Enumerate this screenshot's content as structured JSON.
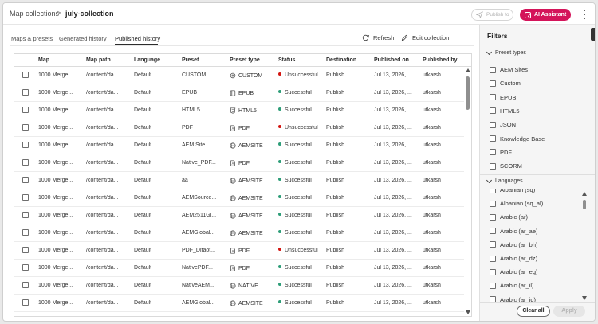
{
  "breadcrumb": {
    "parent": "Map collections",
    "separator": ">",
    "current": "july-collection"
  },
  "header": {
    "publish_label": "Publish to",
    "ai_label": "AI Assistant",
    "ai_color": "#d4145a"
  },
  "tabs": [
    {
      "label": "Maps & presets"
    },
    {
      "label": "Generated history"
    },
    {
      "label": "Published history",
      "active": true
    }
  ],
  "actions": {
    "refresh": "Refresh",
    "edit": "Edit collection"
  },
  "table": {
    "columns": [
      "Map",
      "Map path",
      "Language",
      "Preset",
      "Preset type",
      "Status",
      "Destination",
      "Published on",
      "Published by"
    ],
    "rows": [
      {
        "map": "1000 Merge...",
        "path": "/content/da...",
        "lang": "Default",
        "preset": "CUSTOM",
        "ptype": "CUSTOM",
        "picon": "gear-icon",
        "status": "Unsuccessful",
        "ok": false,
        "dest": "Publish",
        "date": "Jul 13, 2026, ...",
        "by": "utkarsh"
      },
      {
        "map": "1000 Merge...",
        "path": "/content/da...",
        "lang": "Default",
        "preset": "EPUB",
        "ptype": "EPUB",
        "picon": "book-icon",
        "status": "Successful",
        "ok": true,
        "dest": "Publish",
        "date": "Jul 13, 2026, ...",
        "by": "utkarsh"
      },
      {
        "map": "1000 Merge...",
        "path": "/content/da...",
        "lang": "Default",
        "preset": "HTML5",
        "ptype": "HTML5",
        "picon": "html5-icon",
        "status": "Successful",
        "ok": true,
        "dest": "Publish",
        "date": "Jul 13, 2026, ...",
        "by": "utkarsh"
      },
      {
        "map": "1000 Merge...",
        "path": "/content/da...",
        "lang": "Default",
        "preset": "PDF",
        "ptype": "PDF",
        "picon": "pdf-icon",
        "status": "Unsuccessful",
        "ok": false,
        "dest": "Publish",
        "date": "Jul 13, 2026, ...",
        "by": "utkarsh"
      },
      {
        "map": "1000 Merge...",
        "path": "/content/da...",
        "lang": "Default",
        "preset": "AEM Site",
        "ptype": "AEMSITE",
        "picon": "globe-icon",
        "status": "Successful",
        "ok": true,
        "dest": "Publish",
        "date": "Jul 13, 2026, ...",
        "by": "utkarsh"
      },
      {
        "map": "1000 Merge...",
        "path": "/content/da...",
        "lang": "Default",
        "preset": "Native_PDF...",
        "ptype": "PDF",
        "picon": "pdf-icon",
        "status": "Successful",
        "ok": true,
        "dest": "Publish",
        "date": "Jul 13, 2026, ...",
        "by": "utkarsh"
      },
      {
        "map": "1000 Merge...",
        "path": "/content/da...",
        "lang": "Default",
        "preset": "aa",
        "ptype": "AEMSITE",
        "picon": "globe-icon",
        "status": "Successful",
        "ok": true,
        "dest": "Publish",
        "date": "Jul 13, 2026, ...",
        "by": "utkarsh"
      },
      {
        "map": "1000 Merge...",
        "path": "/content/da...",
        "lang": "Default",
        "preset": "AEMSource...",
        "ptype": "AEMSITE",
        "picon": "globe-icon",
        "status": "Successful",
        "ok": true,
        "dest": "Publish",
        "date": "Jul 13, 2026, ...",
        "by": "utkarsh"
      },
      {
        "map": "1000 Merge...",
        "path": "/content/da...",
        "lang": "Default",
        "preset": "AEM2511Gl...",
        "ptype": "AEMSITE",
        "picon": "globe-icon",
        "status": "Successful",
        "ok": true,
        "dest": "Publish",
        "date": "Jul 13, 2026, ...",
        "by": "utkarsh"
      },
      {
        "map": "1000 Merge...",
        "path": "/content/da...",
        "lang": "Default",
        "preset": "AEMGlobal...",
        "ptype": "AEMSITE",
        "picon": "globe-icon",
        "status": "Successful",
        "ok": true,
        "dest": "Publish",
        "date": "Jul 13, 2026, ...",
        "by": "utkarsh"
      },
      {
        "map": "1000 Merge...",
        "path": "/content/da...",
        "lang": "Default",
        "preset": "PDF_Dltaot...",
        "ptype": "PDF",
        "picon": "pdf-icon",
        "status": "Unsuccessful",
        "ok": false,
        "dest": "Publish",
        "date": "Jul 13, 2026, ...",
        "by": "utkarsh"
      },
      {
        "map": "1000 Merge...",
        "path": "/content/da...",
        "lang": "Default",
        "preset": "NativePDF...",
        "ptype": "PDF",
        "picon": "pdf-icon",
        "status": "Successful",
        "ok": true,
        "dest": "Publish",
        "date": "Jul 13, 2026, ...",
        "by": "utkarsh"
      },
      {
        "map": "1000 Merge...",
        "path": "/content/da...",
        "lang": "Default",
        "preset": "NativeAEM...",
        "ptype": "NATIVE...",
        "picon": "globe-icon",
        "status": "Successful",
        "ok": true,
        "dest": "Publish",
        "date": "Jul 13, 2026, ...",
        "by": "utkarsh"
      },
      {
        "map": "1000 Merge...",
        "path": "/content/da...",
        "lang": "Default",
        "preset": "AEMGlobal...",
        "ptype": "AEMSITE",
        "picon": "globe-icon",
        "status": "Successful",
        "ok": true,
        "dest": "Publish",
        "date": "Jul 13, 2026, ...",
        "by": "utkarsh"
      }
    ],
    "status_colors": {
      "ok": "#2d9d78",
      "bad": "#d31510"
    }
  },
  "filters": {
    "title": "Filters",
    "preset_types_label": "Preset types",
    "preset_types": [
      "AEM Sites",
      "Custom",
      "EPUB",
      "HTML5",
      "JSON",
      "Knowledge Base",
      "PDF",
      "SCORM"
    ],
    "languages_label": "Languages",
    "languages": [
      "Albanian (sq)",
      "Albanian (sq_al)",
      "Arabic (ar)",
      "Arabic (ar_ae)",
      "Arabic (ar_bh)",
      "Arabic (ar_dz)",
      "Arabic (ar_eg)",
      "Arabic (ar_il)",
      "Arabic (ar_iq)"
    ],
    "clear_label": "Clear all",
    "apply_label": "Apply"
  }
}
